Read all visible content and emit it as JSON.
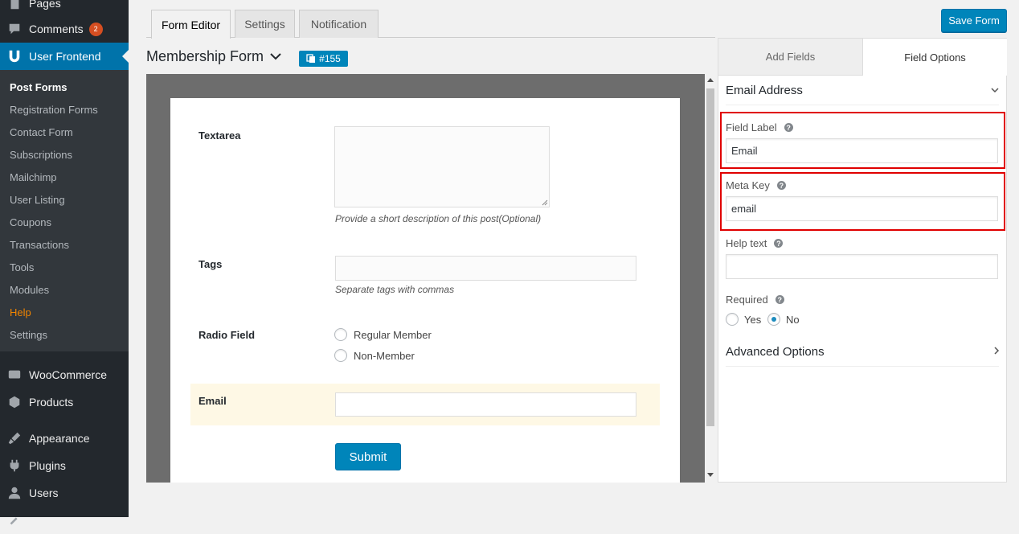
{
  "sidebar": {
    "menu": [
      {
        "label": "Pages",
        "icon": "pages-icon"
      },
      {
        "label": "Comments",
        "icon": "comments-icon",
        "badge": "2"
      },
      {
        "label": "User Frontend",
        "icon": "user-frontend-icon"
      }
    ],
    "submenu": [
      "Post Forms",
      "Registration Forms",
      "Contact Form",
      "Subscriptions",
      "Mailchimp",
      "User Listing",
      "Coupons",
      "Transactions",
      "Tools",
      "Modules",
      "Help",
      "Settings"
    ],
    "menu2": [
      {
        "label": "WooCommerce",
        "icon": "woocommerce-icon"
      },
      {
        "label": "Products",
        "icon": "products-icon"
      },
      {
        "label": "Appearance",
        "icon": "appearance-icon"
      },
      {
        "label": "Plugins",
        "icon": "plugins-icon"
      },
      {
        "label": "Users",
        "icon": "users-icon"
      }
    ]
  },
  "tabs": [
    "Form Editor",
    "Settings",
    "Notification"
  ],
  "save_label": "Save Form",
  "form": {
    "title": "Membership Form",
    "id": "#155",
    "fields": {
      "textarea": {
        "label": "Textarea",
        "help": "Provide a short description of this post(Optional)"
      },
      "tags": {
        "label": "Tags",
        "help": "Separate tags with commas"
      },
      "radio": {
        "label": "Radio Field",
        "options": [
          "Regular Member",
          "Non-Member"
        ]
      },
      "email": {
        "label": "Email"
      }
    },
    "submit": "Submit"
  },
  "panel": {
    "tabs": [
      "Add Fields",
      "Field Options"
    ],
    "section_title": "Email Address",
    "field_label": {
      "label": "Field Label",
      "value": "Email"
    },
    "meta_key": {
      "label": "Meta Key",
      "value": "email"
    },
    "help_text": {
      "label": "Help text",
      "value": ""
    },
    "required": {
      "label": "Required",
      "options": [
        "Yes",
        "No"
      ],
      "selected": "No"
    },
    "advanced": "Advanced Options"
  },
  "colors": {
    "accent": "#0073aa",
    "highlight": "#e00000"
  }
}
